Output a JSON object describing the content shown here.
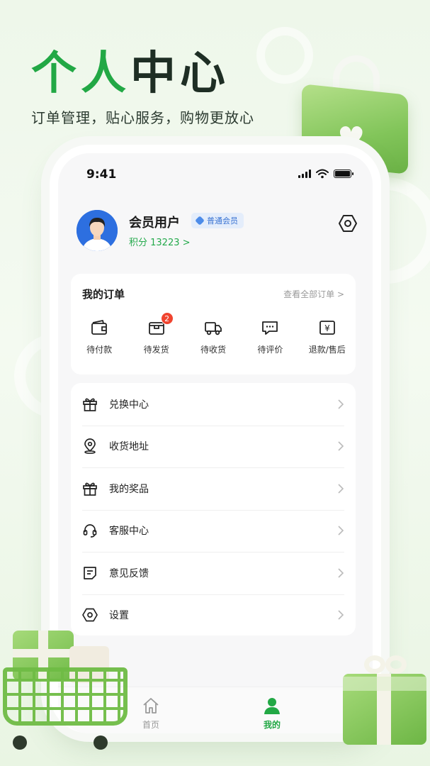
{
  "promo": {
    "headline_green": "个人",
    "headline_dark": "中心",
    "subhead": "订单管理，贴心服务，购物更放心"
  },
  "status_bar": {
    "time": "9:41"
  },
  "profile": {
    "username": "会员用户",
    "level_badge": "普通会员",
    "points_label": "积分 13223 >"
  },
  "orders": {
    "title": "我的订单",
    "view_all": "查看全部订单 >",
    "items": [
      {
        "label": "待付款",
        "icon": "wallet-icon"
      },
      {
        "label": "待发货",
        "icon": "package-icon",
        "badge": "2"
      },
      {
        "label": "待收货",
        "icon": "truck-icon"
      },
      {
        "label": "待评价",
        "icon": "comment-icon"
      },
      {
        "label": "退款/售后",
        "icon": "refund-icon"
      }
    ]
  },
  "menu": {
    "items": [
      {
        "label": "兑换中心",
        "icon": "gift-icon"
      },
      {
        "label": "收货地址",
        "icon": "location-pin-icon"
      },
      {
        "label": "我的奖品",
        "icon": "gift-icon"
      },
      {
        "label": "客服中心",
        "icon": "headset-icon"
      },
      {
        "label": "意见反馈",
        "icon": "feedback-icon"
      },
      {
        "label": "设置",
        "icon": "settings-icon"
      }
    ]
  },
  "tabbar": {
    "home": "首页",
    "mine": "我的"
  },
  "colors": {
    "accent": "#22a845",
    "badge": "#f0442f",
    "level_text": "#3872d2"
  }
}
